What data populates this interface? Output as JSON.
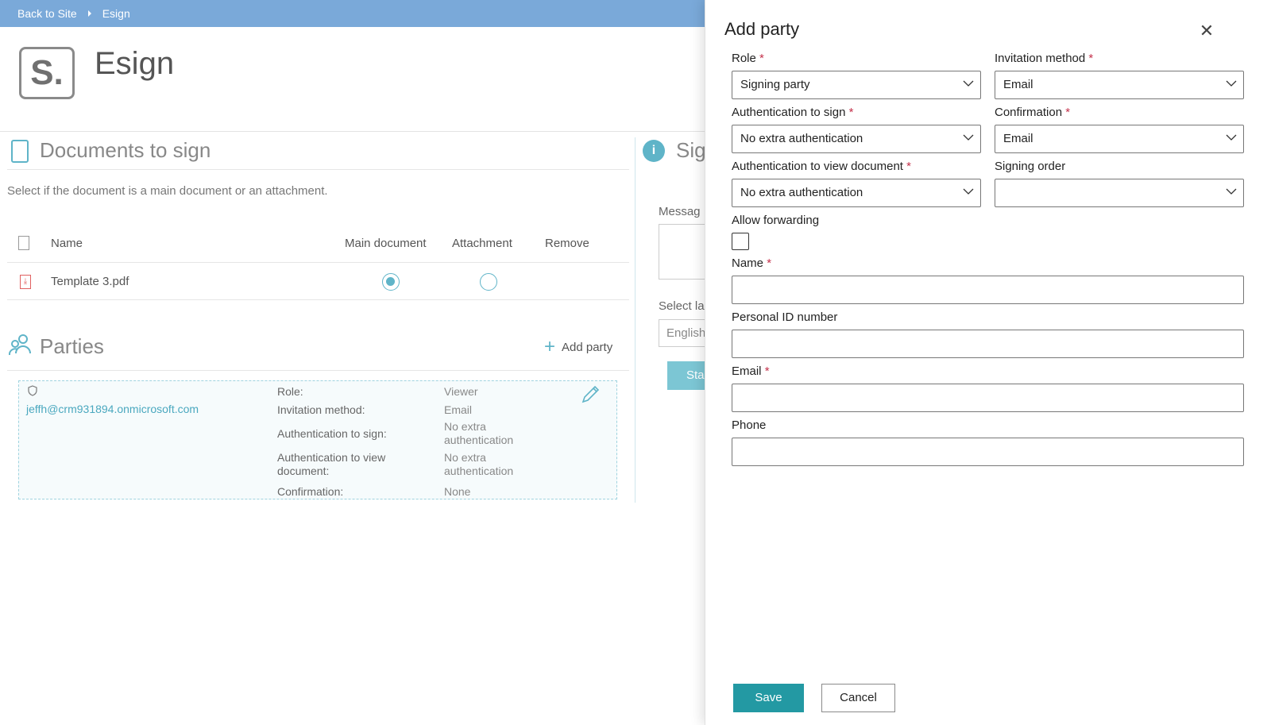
{
  "breadcrumb": {
    "back": "Back to Site",
    "current": "Esign"
  },
  "header": {
    "logo_text": "S.",
    "title": "Esign"
  },
  "documents": {
    "title": "Documents to sign",
    "hint": "Select if the document is a main document or an attachment.",
    "columns": {
      "name": "Name",
      "main": "Main document",
      "attachment": "Attachment",
      "remove": "Remove"
    },
    "rows": [
      {
        "name": "Template 3.pdf",
        "main_selected": true,
        "attachment_selected": false
      }
    ]
  },
  "parties": {
    "title": "Parties",
    "add_label": "Add party",
    "items": [
      {
        "email": "jeffh@crm931894.onmicrosoft.com",
        "role_label": "Role:",
        "role": "Viewer",
        "invitation_label": "Invitation method:",
        "invitation": "Email",
        "auth_sign_label": "Authentication to sign:",
        "auth_sign": "No extra authentication",
        "auth_view_label": "Authentication to view document:",
        "auth_view": "No extra authentication",
        "confirmation_label": "Confirmation:",
        "confirmation": "None"
      }
    ]
  },
  "sign_section": {
    "title": "Sig",
    "message_label": "Messag",
    "language_label": "Select la",
    "language_value": "English",
    "start_label": "Sta"
  },
  "panel": {
    "title": "Add party",
    "role_label": "Role",
    "role_value": "Signing party",
    "invitation_label": "Invitation method",
    "invitation_value": "Email",
    "auth_sign_label": "Authentication to sign",
    "auth_sign_value": "No extra authentication",
    "confirmation_label": "Confirmation",
    "confirmation_value": "Email",
    "auth_view_label": "Authentication to view document",
    "auth_view_value": "No extra authentication",
    "signing_order_label": "Signing order",
    "signing_order_value": "",
    "allow_forwarding_label": "Allow forwarding",
    "name_label": "Name",
    "personal_id_label": "Personal ID number",
    "email_label": "Email",
    "phone_label": "Phone",
    "required_mark": "*",
    "save_label": "Save",
    "cancel_label": "Cancel"
  },
  "colors": {
    "accent": "#5fb4c8",
    "topbar": "#7aa9d9",
    "primary_button": "#2399a3",
    "required": "#c4314b"
  }
}
